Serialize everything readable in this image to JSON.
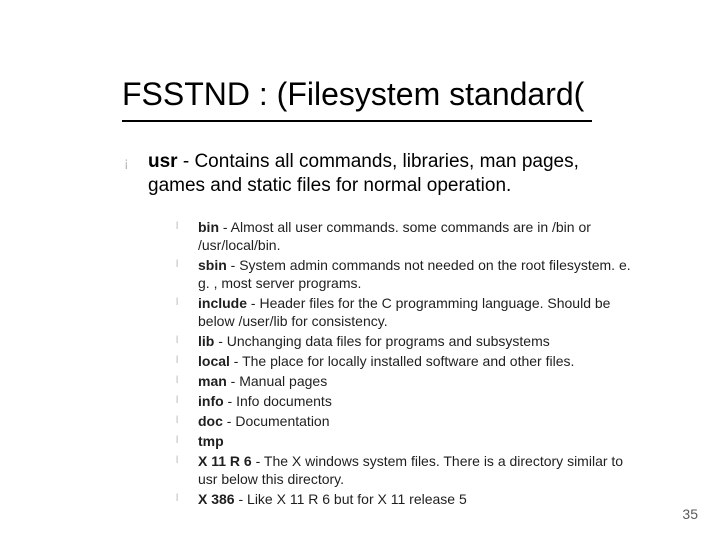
{
  "title": "FSSTND : (Filesystem standard(",
  "level1": {
    "key": "usr",
    "desc": " - Contains all commands, libraries, man pages, games and static files for normal operation."
  },
  "level2": [
    {
      "key": "bin",
      "desc": " - Almost all user commands. some commands are in /bin or /usr/local/bin."
    },
    {
      "key": "sbin",
      "desc": " - System admin commands not needed on the root filesystem. e. g. , most server programs."
    },
    {
      "key": "include",
      "desc": " - Header files for the C programming language. Should be below /user/lib for consistency."
    },
    {
      "key": "lib",
      "desc": " - Unchanging data files for programs and subsystems"
    },
    {
      "key": "local",
      "desc": " - The place for locally installed software and other files."
    },
    {
      "key": "man",
      "desc": " - Manual pages"
    },
    {
      "key": "info",
      "desc": " - Info documents"
    },
    {
      "key": "doc",
      "desc": " - Documentation"
    },
    {
      "key": "tmp",
      "desc": ""
    },
    {
      "key": "X 11 R 6",
      "desc": " - The X windows system files. There is a directory similar to usr below this directory."
    },
    {
      "key": "X 386",
      "desc": " - Like X 11 R 6 but for X 11 release 5"
    }
  ],
  "page_number": "35"
}
